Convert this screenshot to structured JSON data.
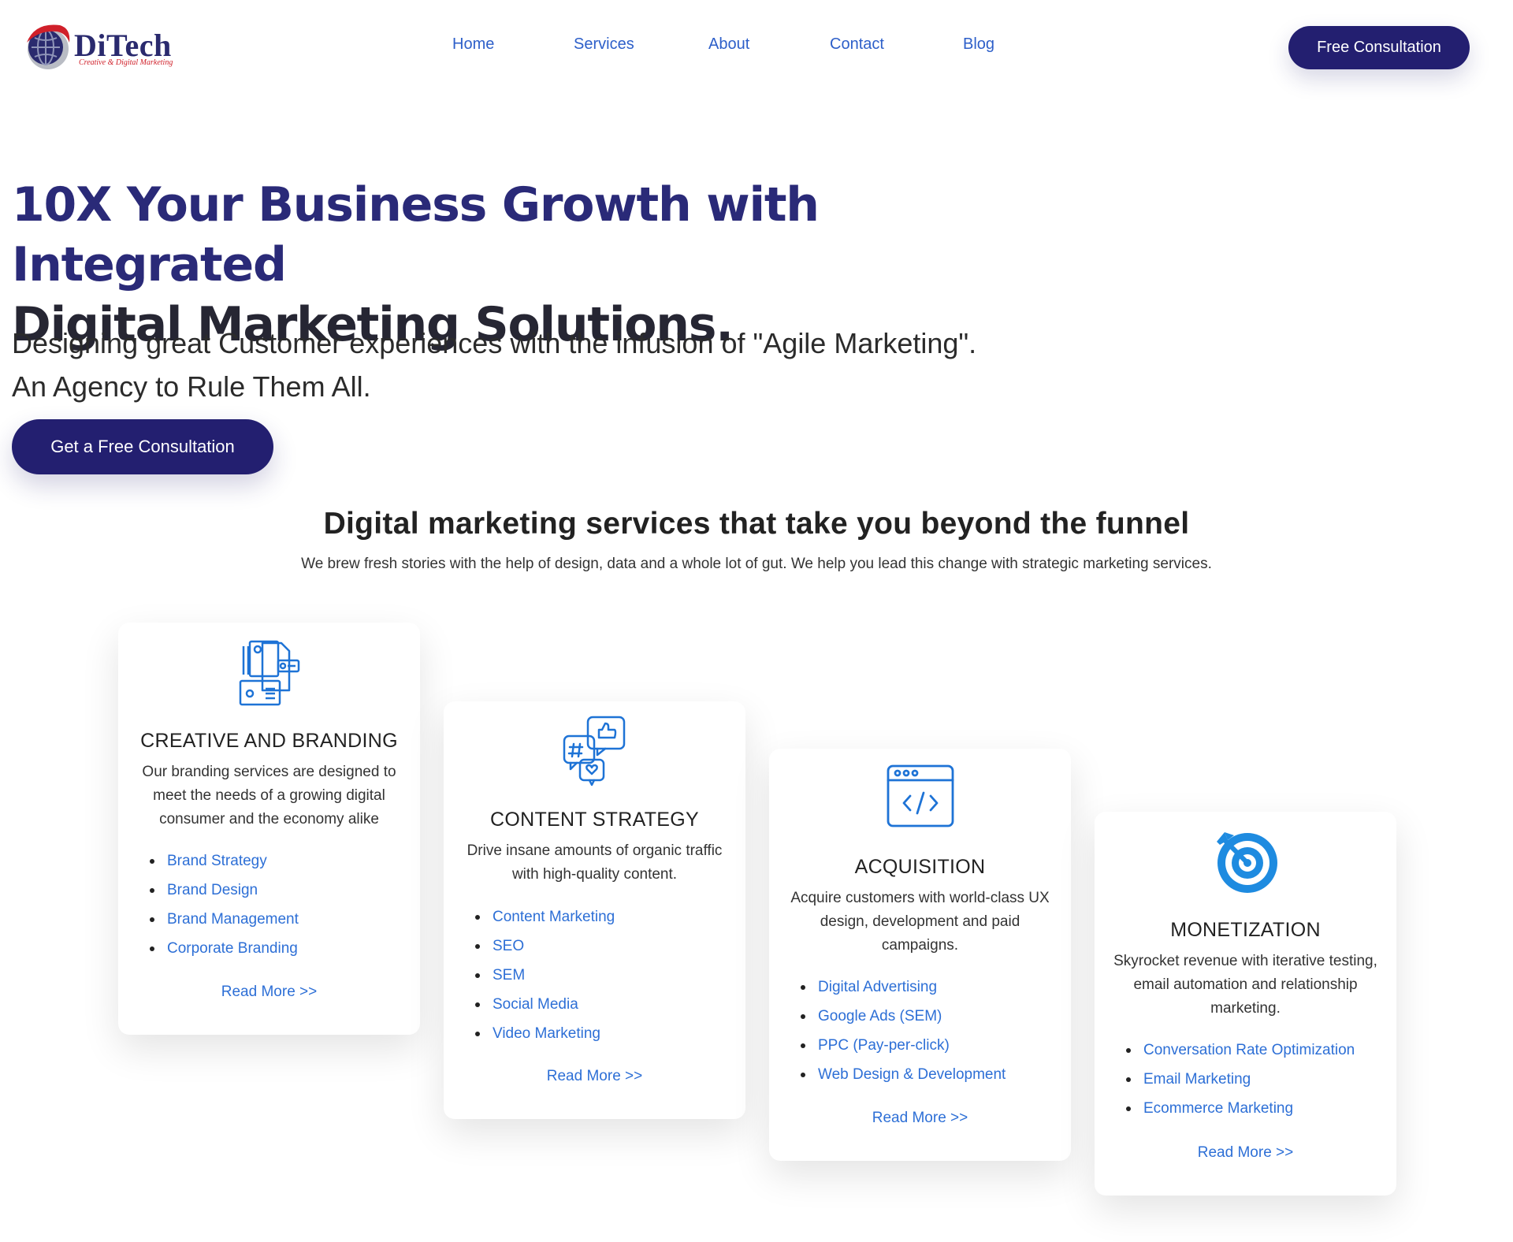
{
  "brand": {
    "name": "DiTech",
    "tagline": "Creative & Digital Marketing"
  },
  "nav": {
    "items": [
      "Home",
      "Services",
      "About",
      "Contact",
      "Blog"
    ]
  },
  "header": {
    "cta_label": "Free Consultation"
  },
  "hero": {
    "title_line1": "10X Your Business Growth with Integrated",
    "title_line2": "Digital Marketing Solutions.",
    "subtitle_line1": "Designing great Customer experiences with the infusion of \"Agile Marketing\".",
    "subtitle_line2": "An Agency to Rule Them All.",
    "cta_label": "Get a Free Consultation"
  },
  "services": {
    "title": "Digital marketing services that take you beyond the funnel",
    "subtitle": "We brew fresh stories with the help of design, data and a whole lot of gut. We help you lead this change with strategic marketing services.",
    "cards": [
      {
        "icon": "branding-documents-icon",
        "title": "CREATIVE AND BRANDING",
        "description": "Our branding services are designed to meet the needs of a growing digital consumer and the economy alike",
        "items": [
          "Brand Strategy",
          "Brand Design",
          "Brand Management",
          "Corporate Branding"
        ],
        "link": "Read More >>"
      },
      {
        "icon": "social-chat-icon",
        "title": "CONTENT STRATEGY",
        "description": "Drive insane amounts of organic traffic with high-quality content.",
        "items": [
          "Content Marketing",
          "SEO",
          "SEM",
          "Social Media",
          "Video Marketing"
        ],
        "link": "Read More >>"
      },
      {
        "icon": "code-window-icon",
        "title": "ACQUISITION",
        "description": "Acquire customers with world-class UX design, development and paid campaigns.",
        "items": [
          "Digital Advertising",
          "Google Ads (SEM)",
          "PPC (Pay-per-click)",
          "Web Design & Development"
        ],
        "link": "Read More >>"
      },
      {
        "icon": "target-icon",
        "title": "MONETIZATION",
        "description": "Skyrocket revenue with iterative testing, email automation and relationship marketing.",
        "items": [
          "Conversation Rate Optimization",
          "Email Marketing",
          "Ecommerce Marketing"
        ],
        "link": "Read More >>"
      }
    ]
  },
  "colors": {
    "primary": "#231f70",
    "link": "#2d6fd6",
    "nav": "#2d5fc9",
    "logo_red": "#d0202a"
  }
}
